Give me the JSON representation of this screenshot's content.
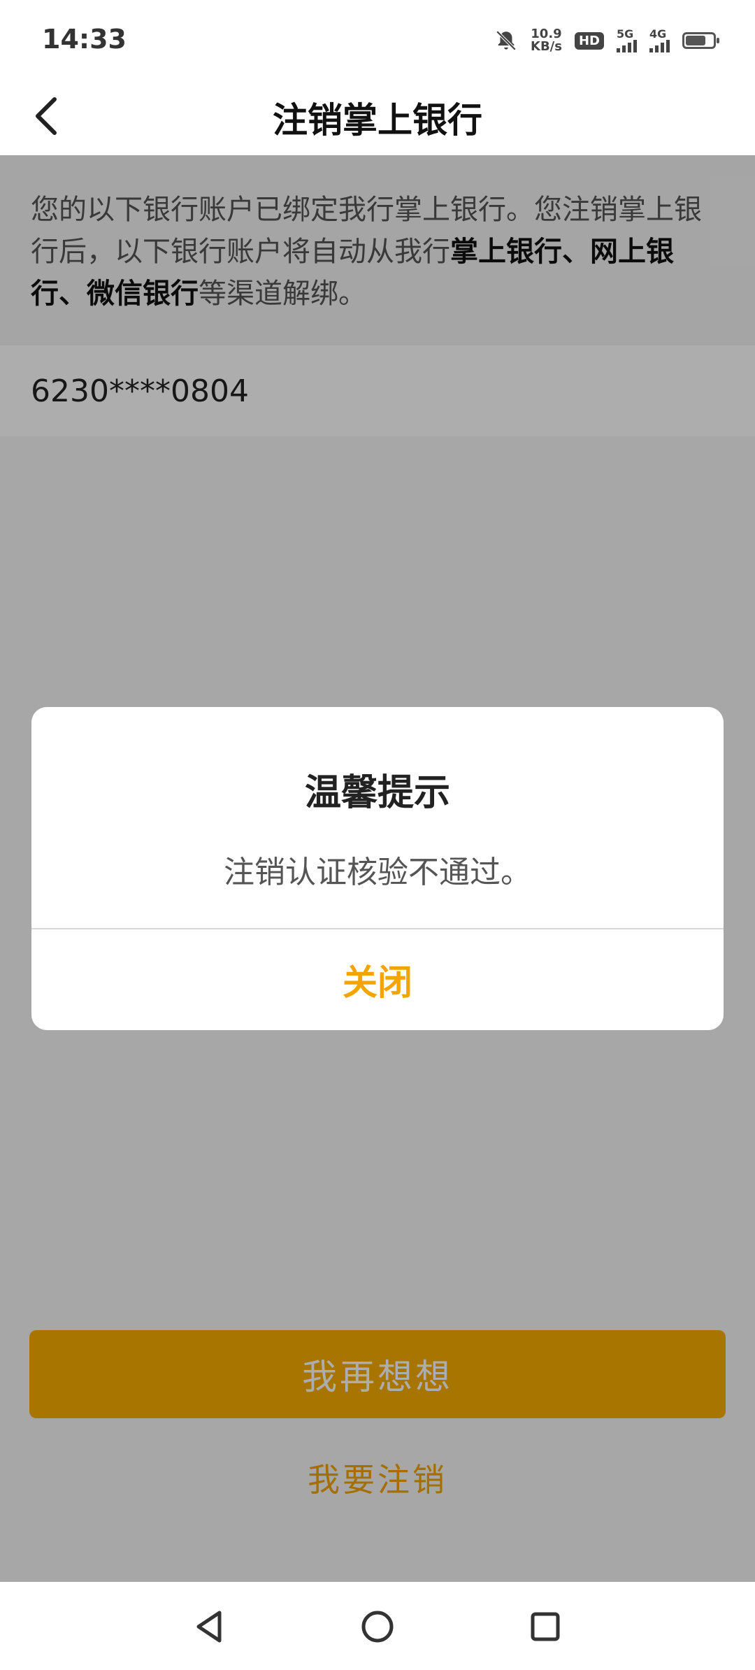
{
  "status_bar": {
    "time": "14:33",
    "net_speed_value": "10.9",
    "net_speed_unit": "KB/s",
    "hd_label": "HD",
    "signal_1": "5G",
    "signal_2": "4G",
    "icons": [
      "bell-off-icon",
      "hd-icon",
      "signal-5g-icon",
      "signal-4g-icon",
      "battery-icon"
    ]
  },
  "header": {
    "title": "注销掌上银行",
    "back_icon": "chevron-left-icon"
  },
  "notice": {
    "text_part1": "您的以下银行账户已绑定我行掌上银行。您注销掌上银行后，以下银行账户将自动从我行",
    "text_bold": "掌上银行、网上银行、微信银行",
    "text_part2": "等渠道解绑。"
  },
  "account": {
    "number": "6230****0804"
  },
  "actions": {
    "primary_label": "我再想想",
    "secondary_label": "我要注销"
  },
  "dialog": {
    "title": "温馨提示",
    "message": "注销认证核验不通过。",
    "close_label": "关闭"
  },
  "system_nav": {
    "icons": [
      "back-triangle-icon",
      "home-circle-icon",
      "recents-square-icon"
    ]
  },
  "colors": {
    "accent": "#f3a400",
    "primary_button": "#f8ad00"
  }
}
